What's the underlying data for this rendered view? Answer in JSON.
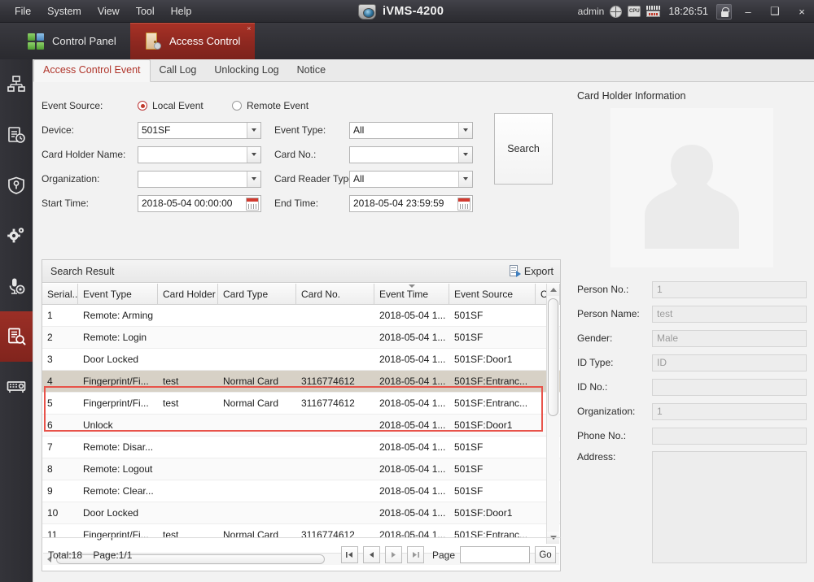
{
  "titlebar": {
    "menus": [
      "File",
      "System",
      "View",
      "Tool",
      "Help"
    ],
    "app_name": "iVMS-4200",
    "user": "admin",
    "clock": "18:26:51",
    "icons": [
      "globe-icon",
      "cpu-icon",
      "ram-icon",
      "lock-icon"
    ],
    "cpu_label": "CPU",
    "ram_label": "RAM",
    "minimize": "–",
    "maximize": "❑",
    "close": "×"
  },
  "tabs": [
    {
      "label": "Control Panel",
      "icon": "grid-icon",
      "active": false
    },
    {
      "label": "Access Control",
      "icon": "door-person-icon",
      "active": true,
      "close": "×"
    }
  ],
  "sidebar": {
    "items": [
      {
        "name": "device-management",
        "icon": "device-tree-icon",
        "active": false
      },
      {
        "name": "event-log",
        "icon": "clipboard-clock-icon",
        "active": false
      },
      {
        "name": "security-control",
        "icon": "shield-key-icon",
        "active": false
      },
      {
        "name": "system-configuration",
        "icon": "gears-icon",
        "active": false
      },
      {
        "name": "audio-broadcast",
        "icon": "microphone-icon",
        "active": false
      },
      {
        "name": "access-control-search",
        "icon": "document-search-icon",
        "active": true
      },
      {
        "name": "encoding-device",
        "icon": "encoder-device-icon",
        "active": false
      }
    ]
  },
  "subtabs": [
    {
      "label": "Access Control Event",
      "active": true
    },
    {
      "label": "Call Log",
      "active": false
    },
    {
      "label": "Unlocking Log",
      "active": false
    },
    {
      "label": "Notice",
      "active": false
    }
  ],
  "search_form": {
    "event_source_label": "Event Source:",
    "local_event_label": "Local Event",
    "remote_event_label": "Remote Event",
    "local_event_selected": true,
    "device_label": "Device:",
    "device_value": "501SF",
    "event_type_label": "Event Type:",
    "event_type_value": "All",
    "card_holder_name_label": "Card Holder Name:",
    "card_holder_name_value": "",
    "card_no_label": "Card No.:",
    "card_no_value": "",
    "organization_label": "Organization:",
    "organization_value": "",
    "card_reader_type_label": "Card Reader Type:",
    "card_reader_type_value": "All",
    "start_time_label": "Start Time:",
    "start_time_value": "2018-05-04 00:00:00",
    "end_time_label": "End Time:",
    "end_time_value": "2018-05-04 23:59:59",
    "search_button": "Search"
  },
  "results": {
    "title": "Search Result",
    "export_label": "Export",
    "columns": [
      "Serial...",
      "Event Type",
      "Card Holder",
      "Card Type",
      "Card No.",
      "Event Time",
      "Event Source",
      "C"
    ],
    "sorted_column": "Event Time",
    "rows": [
      {
        "serial": "1",
        "event_type": "Remote: Arming",
        "card_holder": "",
        "card_type": "",
        "card_no": "",
        "event_time": "2018-05-04 1...",
        "event_source": "501SF",
        "selected": false,
        "highlighted": false
      },
      {
        "serial": "2",
        "event_type": "Remote: Login",
        "card_holder": "",
        "card_type": "",
        "card_no": "",
        "event_time": "2018-05-04 1...",
        "event_source": "501SF",
        "selected": false,
        "highlighted": false
      },
      {
        "serial": "3",
        "event_type": "Door Locked",
        "card_holder": "",
        "card_type": "",
        "card_no": "",
        "event_time": "2018-05-04 1...",
        "event_source": "501SF:Door1",
        "selected": false,
        "highlighted": false
      },
      {
        "serial": "4",
        "event_type": "Fingerprint/Fi...",
        "card_holder": "test",
        "card_type": "Normal Card",
        "card_no": "3116774612",
        "event_time": "2018-05-04 1...",
        "event_source": "501SF:Entranc...",
        "selected": true,
        "highlighted": true
      },
      {
        "serial": "5",
        "event_type": "Fingerprint/Fi...",
        "card_holder": "test",
        "card_type": "Normal Card",
        "card_no": "3116774612",
        "event_time": "2018-05-04 1...",
        "event_source": "501SF:Entranc...",
        "selected": false,
        "highlighted": true
      },
      {
        "serial": "6",
        "event_type": "Unlock",
        "card_holder": "",
        "card_type": "",
        "card_no": "",
        "event_time": "2018-05-04 1...",
        "event_source": "501SF:Door1",
        "selected": false,
        "highlighted": false
      },
      {
        "serial": "7",
        "event_type": "Remote: Disar...",
        "card_holder": "",
        "card_type": "",
        "card_no": "",
        "event_time": "2018-05-04 1...",
        "event_source": "501SF",
        "selected": false,
        "highlighted": false
      },
      {
        "serial": "8",
        "event_type": "Remote: Logout",
        "card_holder": "",
        "card_type": "",
        "card_no": "",
        "event_time": "2018-05-04 1...",
        "event_source": "501SF",
        "selected": false,
        "highlighted": false
      },
      {
        "serial": "9",
        "event_type": "Remote: Clear...",
        "card_holder": "",
        "card_type": "",
        "card_no": "",
        "event_time": "2018-05-04 1...",
        "event_source": "501SF",
        "selected": false,
        "highlighted": false
      },
      {
        "serial": "10",
        "event_type": "Door Locked",
        "card_holder": "",
        "card_type": "",
        "card_no": "",
        "event_time": "2018-05-04 1...",
        "event_source": "501SF:Door1",
        "selected": false,
        "highlighted": false
      },
      {
        "serial": "11",
        "event_type": "Fingerprint/Fi...",
        "card_holder": "test",
        "card_type": "Normal Card",
        "card_no": "3116774612",
        "event_time": "2018-05-04 1...",
        "event_source": "501SF:Entranc...",
        "selected": false,
        "highlighted": false
      }
    ]
  },
  "pagination": {
    "total": "Total:18",
    "page_info": "Page:1/1",
    "page_label": "Page",
    "page_value": "",
    "go_label": "Go",
    "first": "first-page-icon",
    "prev": "prev-page-icon",
    "next": "next-page-icon",
    "last": "last-page-icon"
  },
  "card_holder": {
    "title": "Card Holder Information",
    "photo_placeholder": "person-silhouette-icon",
    "fields": [
      {
        "label": "Person No.:",
        "value": "1"
      },
      {
        "label": "Person Name:",
        "value": "test"
      },
      {
        "label": "Gender:",
        "value": "Male"
      },
      {
        "label": "ID Type:",
        "value": "ID"
      },
      {
        "label": "ID No.:",
        "value": ""
      },
      {
        "label": "Organization:",
        "value": "1"
      },
      {
        "label": "Phone No.:",
        "value": ""
      }
    ],
    "address_label": "Address:",
    "address_value": ""
  },
  "colors": {
    "accent_red": "#a93226",
    "highlight_red": "#e8534a",
    "titlebar_dark": "#36363c",
    "selected_row": "#d7d1c6"
  }
}
